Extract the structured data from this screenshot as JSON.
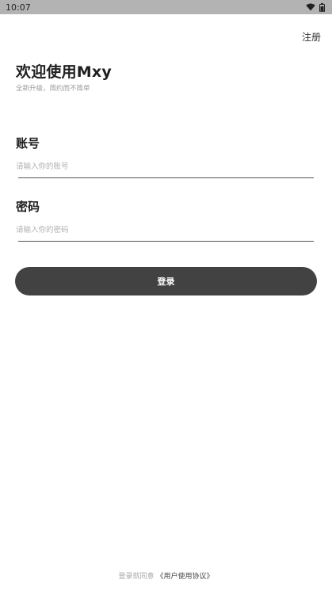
{
  "status_bar": {
    "time": "10:07",
    "icons": [
      "wifi-icon",
      "battery-icon"
    ]
  },
  "header": {
    "register_label": "注册"
  },
  "welcome": {
    "title": "欢迎使用Mxy",
    "subtitle": "全新升级，简约而不简单"
  },
  "form": {
    "account_label": "账号",
    "account_placeholder": "请输入你的账号",
    "account_value": "",
    "password_label": "密码",
    "password_placeholder": "请输入你的密码",
    "password_value": ""
  },
  "login": {
    "button_label": "登录"
  },
  "footer": {
    "agreement_prefix": "登录就同意",
    "agreement_link": "《用户使用协议》"
  },
  "colors": {
    "status_bar_bg": "#b3b3b3",
    "button_bg": "#424242",
    "button_text": "#ffffff",
    "placeholder": "#b0b0b0"
  }
}
